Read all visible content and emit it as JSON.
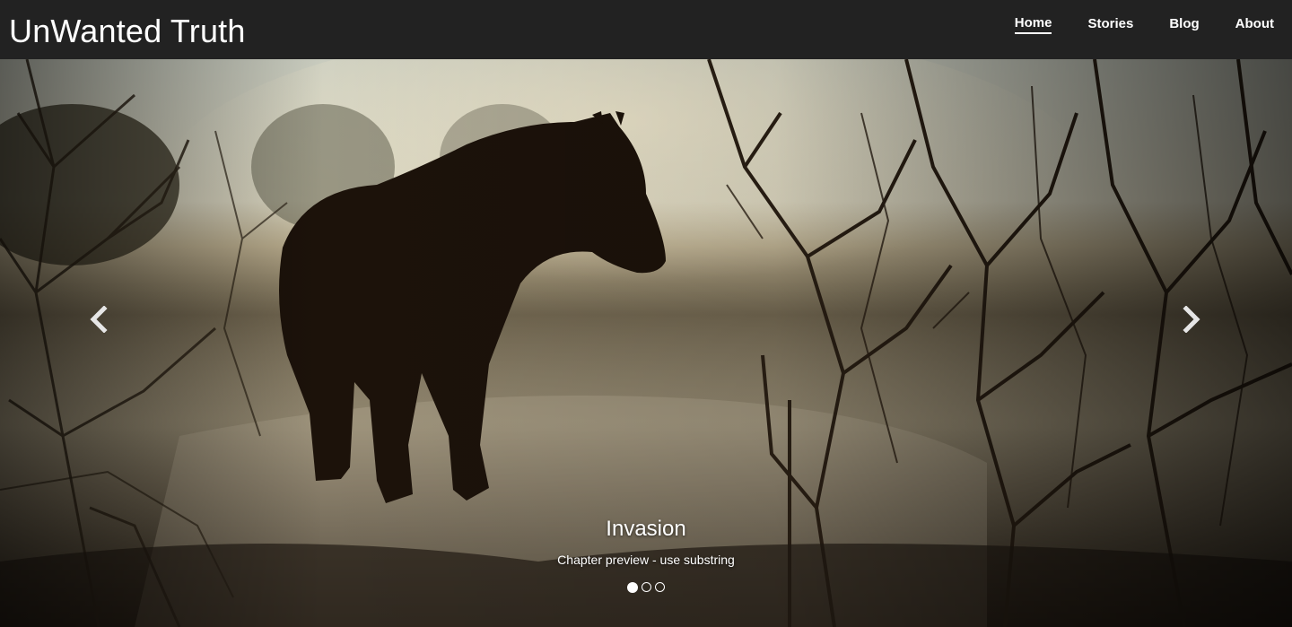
{
  "brand": "UnWanted Truth",
  "nav": {
    "items": [
      {
        "label": "Home",
        "active": true
      },
      {
        "label": "Stories",
        "active": false
      },
      {
        "label": "Blog",
        "active": false
      },
      {
        "label": "About",
        "active": false
      }
    ]
  },
  "carousel": {
    "image_description_icon": "horse-silhouette-image",
    "slide_title": "Invasion",
    "slide_text": "Chapter preview - use substring",
    "slide_count": 3,
    "active_slide": 1,
    "prev_icon": "chevron-left-icon",
    "next_icon": "chevron-right-icon"
  },
  "colors": {
    "navbar": "#222222",
    "text": "#ffffff"
  }
}
